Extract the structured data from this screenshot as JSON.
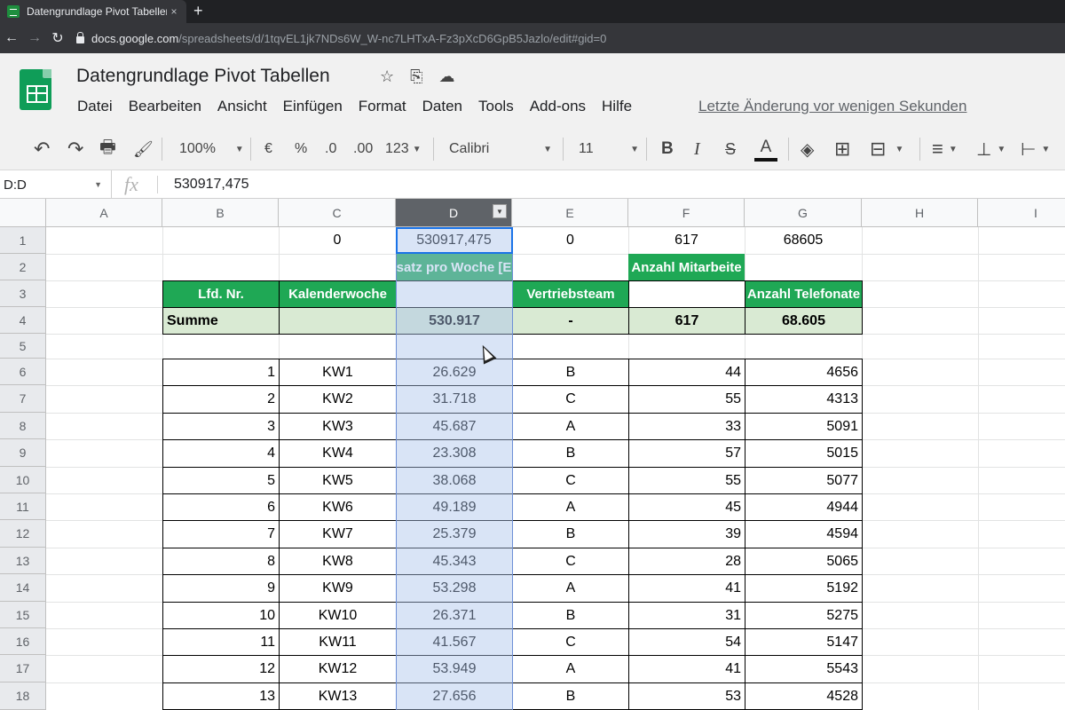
{
  "browser": {
    "tab_title": "Datengrundlage Pivot Tabellen -",
    "tab_close": "×",
    "new_tab": "+",
    "back": "←",
    "forward": "→",
    "reload": "↻",
    "url_host": "docs.google.com",
    "url_path": "/spreadsheets/d/1tqvEL1jk7NDs6W_W-nc7LHTxA-Fz3pXcD6GpB5Jazlo/edit#gid=0"
  },
  "doc": {
    "title": "Datengrundlage Pivot Tabellen",
    "star": "☆",
    "move": "⎘",
    "cloud": "☁"
  },
  "menu": {
    "items": [
      "Datei",
      "Bearbeiten",
      "Ansicht",
      "Einfügen",
      "Format",
      "Daten",
      "Tools",
      "Add-ons",
      "Hilfe"
    ],
    "last_edit": "Letzte Änderung vor wenigen Sekunden"
  },
  "toolbar": {
    "undo": "↶",
    "redo": "↷",
    "print": "🖶",
    "paint": "🖌",
    "zoom": "100%",
    "currency": "€",
    "percent": "%",
    "dec_less": ".0",
    "dec_more": ".00",
    "number_format": "123",
    "font": "Calibri",
    "size": "11",
    "bold": "B",
    "italic": "I",
    "strike": "S",
    "text_color": "A",
    "fill": "◈",
    "borders": "⊞",
    "merge": "⊟",
    "align": "≡",
    "valign": "⊥",
    "wrap": "⊢",
    "caret": "▼"
  },
  "formula_bar": {
    "name_box": "D:D",
    "fx": "fx",
    "value": "530917,475"
  },
  "columns": [
    "A",
    "B",
    "C",
    "D",
    "E",
    "F",
    "G",
    "H",
    "I"
  ],
  "selected_column": "D",
  "rows": [
    "1",
    "2",
    "3",
    "4",
    "5",
    "6",
    "7",
    "8",
    "9",
    "10",
    "11",
    "12",
    "13",
    "14",
    "15",
    "16",
    "17",
    "18"
  ],
  "row1": {
    "c": "0",
    "d": "530917,475",
    "e": "0",
    "f": "617",
    "g": "68605"
  },
  "row2": {
    "d": "satz pro Woche [E",
    "f": "Anzahl Mitarbeite"
  },
  "row3": {
    "b": "Lfd. Nr.",
    "c": "Kalenderwoche",
    "e": "Vertriebsteam",
    "g": "Anzahl Telefonate"
  },
  "row4": {
    "b": "Summe",
    "d": "530.917",
    "e": "-",
    "f": "617",
    "g": "68.605"
  },
  "data_rows": [
    {
      "nr": "1",
      "kw": "KW1",
      "umsatz": "26.629",
      "team": "B",
      "ma": "44",
      "tel": "4656"
    },
    {
      "nr": "2",
      "kw": "KW2",
      "umsatz": "31.718",
      "team": "C",
      "ma": "55",
      "tel": "4313"
    },
    {
      "nr": "3",
      "kw": "KW3",
      "umsatz": "45.687",
      "team": "A",
      "ma": "33",
      "tel": "5091"
    },
    {
      "nr": "4",
      "kw": "KW4",
      "umsatz": "23.308",
      "team": "B",
      "ma": "57",
      "tel": "5015"
    },
    {
      "nr": "5",
      "kw": "KW5",
      "umsatz": "38.068",
      "team": "C",
      "ma": "55",
      "tel": "5077"
    },
    {
      "nr": "6",
      "kw": "KW6",
      "umsatz": "49.189",
      "team": "A",
      "ma": "45",
      "tel": "4944"
    },
    {
      "nr": "7",
      "kw": "KW7",
      "umsatz": "25.379",
      "team": "B",
      "ma": "39",
      "tel": "4594"
    },
    {
      "nr": "8",
      "kw": "KW8",
      "umsatz": "45.343",
      "team": "C",
      "ma": "28",
      "tel": "5065"
    },
    {
      "nr": "9",
      "kw": "KW9",
      "umsatz": "53.298",
      "team": "A",
      "ma": "41",
      "tel": "5192"
    },
    {
      "nr": "10",
      "kw": "KW10",
      "umsatz": "26.371",
      "team": "B",
      "ma": "31",
      "tel": "5275"
    },
    {
      "nr": "11",
      "kw": "KW11",
      "umsatz": "41.567",
      "team": "C",
      "ma": "54",
      "tel": "5147"
    },
    {
      "nr": "12",
      "kw": "KW12",
      "umsatz": "53.949",
      "team": "A",
      "ma": "41",
      "tel": "5543"
    },
    {
      "nr": "13",
      "kw": "KW13",
      "umsatz": "27.656",
      "team": "B",
      "ma": "53",
      "tel": "4528"
    }
  ],
  "colors": {
    "header_green": "#1fa855",
    "sum_green": "#d9ead3",
    "selection": "#aac3eb"
  }
}
